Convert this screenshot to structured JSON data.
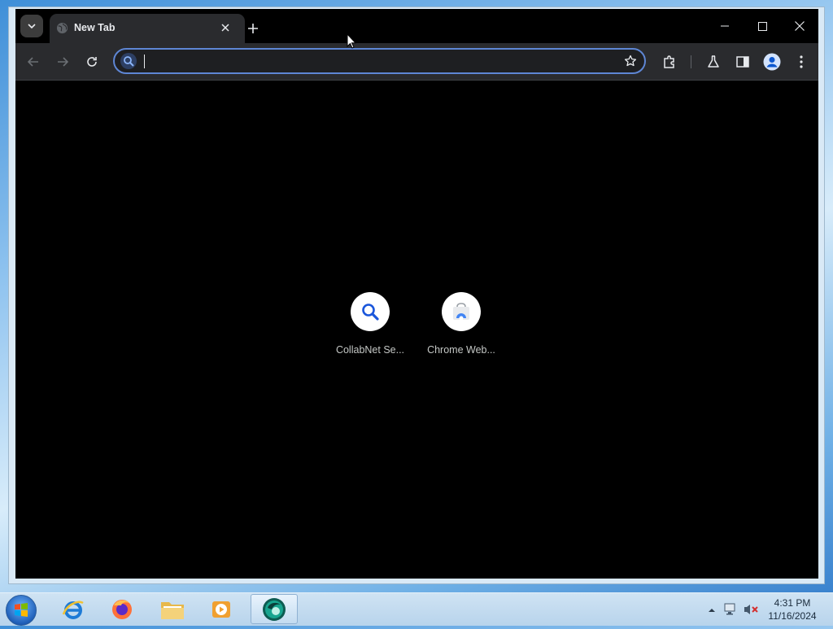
{
  "browser": {
    "tab": {
      "title": "New Tab",
      "favicon": "globe-icon"
    },
    "toolbar": {
      "back": "arrow-left-icon",
      "forward": "arrow-right-icon",
      "reload": "reload-icon",
      "address_value": "",
      "bookmark": "star-icon",
      "extensions": "puzzle-icon",
      "labs": "flask-icon",
      "side_panel": "side-panel-icon",
      "profile": "avatar-icon",
      "menu": "kebab-menu-icon"
    },
    "shortcuts": [
      {
        "label": "CollabNet Se...",
        "icon": "search-icon"
      },
      {
        "label": "Chrome Web...",
        "icon": "chrome-web-store-icon"
      }
    ],
    "accent_color": "#5e86d4"
  },
  "taskbar": {
    "apps": [
      {
        "name": "internet-explorer",
        "icon": "ie-icon"
      },
      {
        "name": "firefox",
        "icon": "firefox-icon"
      },
      {
        "name": "file-explorer",
        "icon": "folder-icon"
      },
      {
        "name": "media-player",
        "icon": "media-player-icon"
      },
      {
        "name": "chrome",
        "icon": "browser-icon",
        "active": true
      }
    ],
    "clock": {
      "time": "4:31 PM",
      "date": "11/16/2024"
    }
  }
}
